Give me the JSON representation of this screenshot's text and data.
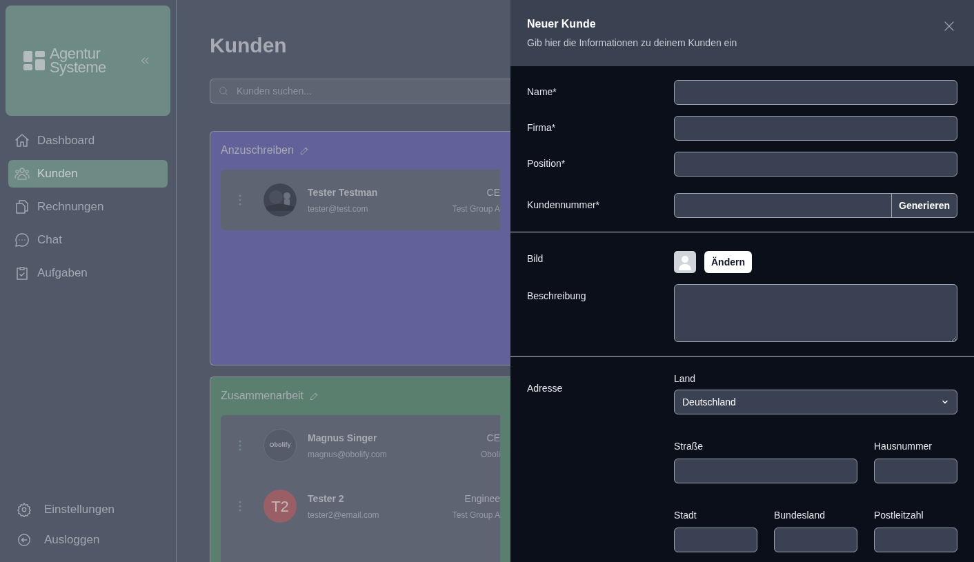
{
  "sidebar": {
    "logo": {
      "line_1": "Agentur",
      "line_2": "Systeme"
    },
    "nav": [
      {
        "label": "Dashboard",
        "selected": false
      },
      {
        "label": "Kunden",
        "selected": true
      },
      {
        "label": "Rechnungen",
        "selected": false
      },
      {
        "label": "Chat",
        "selected": false
      },
      {
        "label": "Aufgaben",
        "selected": false
      }
    ],
    "footer": [
      {
        "label": "Einstellungen"
      },
      {
        "label": "Ausloggen"
      }
    ]
  },
  "main": {
    "title": "Kunden",
    "search": {
      "placeholder": "Kunden suchen..."
    },
    "boards": [
      {
        "title": "Anzuschreiben",
        "color": "#62619a",
        "cards": [
          {
            "name": "Tester Testman",
            "email": "tester@test.com",
            "column_3": "CE",
            "column_4": "Test Group A"
          }
        ]
      },
      {
        "title": "Zusammenarbeit",
        "color": "#5a7f6f",
        "cards": [
          {
            "name": "Magnus Singer",
            "email": "magnus@obolify.com",
            "column_3": "CE",
            "column_4": "Oboli",
            "avatar": {
              "kind": "logo",
              "text": "Obolify"
            }
          },
          {
            "name": "Tester 2",
            "email": "tester2@email.com",
            "column_3": "Enginee",
            "column_4": "Test Group A",
            "avatar": {
              "kind": "initials",
              "text": "T2"
            }
          }
        ]
      }
    ]
  },
  "panel": {
    "title": "Neuer Kunde",
    "subtitle": "Gib hier die Informationen zu deinem Kunden ein",
    "basic_fields": [
      {
        "label": "Name*"
      },
      {
        "label": "Firma*"
      },
      {
        "label": "Position*"
      },
      {
        "label": "Kundennummer*",
        "button": "Generieren"
      }
    ],
    "image": {
      "label": "Bild",
      "button": "Ändern"
    },
    "description": {
      "label": "Beschreibung"
    },
    "address": {
      "label": "Adresse",
      "country": {
        "label": "Land",
        "value": "Deutschland"
      },
      "row_1": [
        {
          "label": "Straße"
        },
        {
          "label": "Hausnummer"
        }
      ],
      "row_2": [
        {
          "label": "Stadt"
        },
        {
          "label": "Bundesland"
        },
        {
          "label": "Postleitzahl"
        }
      ]
    }
  }
}
